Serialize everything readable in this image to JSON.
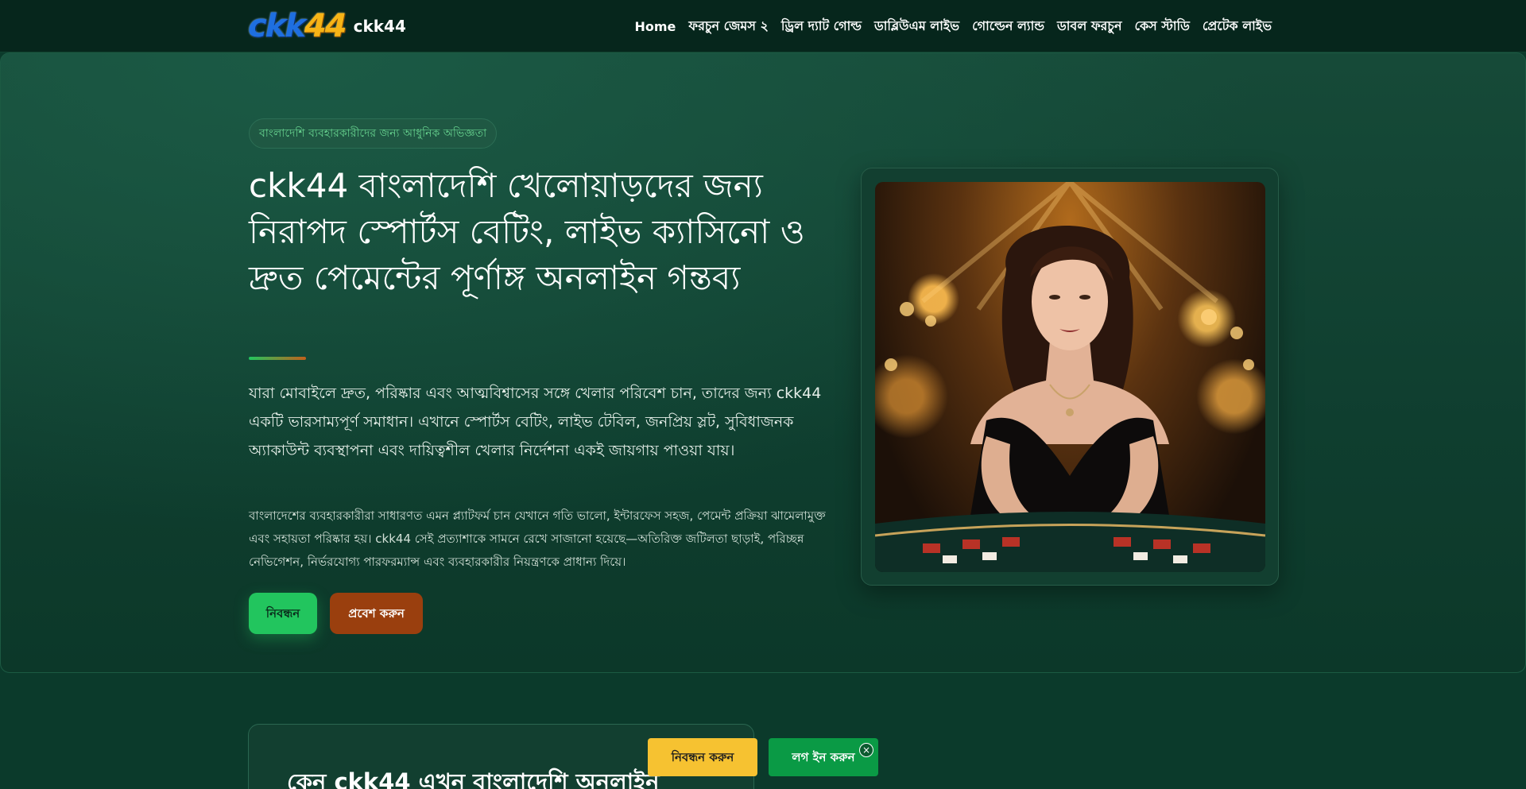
{
  "header": {
    "logo": {
      "part1": "ckk",
      "part2": "44"
    },
    "brand_name": "ckk44",
    "nav": [
      "Home",
      "ফরচুন জেমস ২",
      "ড্রিল দ্যাট গোল্ড",
      "ডাব্লিউএম লাইভ",
      "গোল্ডেন ল্যান্ড",
      "ডাবল ফরচুন",
      "কেস স্টাডি",
      "প্রেটেক লাইভ"
    ]
  },
  "hero": {
    "eyebrow": "বাংলাদেশি ব্যবহারকারীদের জন্য আধুনিক অভিজ্ঞতা",
    "title": "ckk44 বাংলাদেশি খেলোয়াড়দের জন্য নিরাপদ স্পোর্টস বেটিং, লাইভ ক্যাসিনো ও দ্রুত পেমেন্টের পূর্ণাঙ্গ অনলাইন গন্তব্য",
    "lead": "যারা মোবাইলে দ্রুত, পরিষ্কার এবং আত্মবিশ্বাসের সঙ্গে খেলার পরিবেশ চান, তাদের জন্য ckk44 একটি ভারসাম্যপূর্ণ সমাধান। এখানে স্পোর্টস বেটিং, লাইভ টেবিল, জনপ্রিয় স্লট, সুবিধাজনক অ্যাকাউন্ট ব্যবস্থাপনা এবং দায়িত্বশীল খেলার নির্দেশনা একই জায়গায় পাওয়া যায়।",
    "sub": "বাংলাদেশের ব্যবহারকারীরা সাধারণত এমন প্ল্যাটফর্ম চান যেখানে গতি ভালো, ইন্টারফেস সহজ, পেমেন্ট প্রক্রিয়া ঝামেলামুক্ত এবং সহায়তা পরিষ্কার হয়। ckk44 সেই প্রত্যাশাকে সামনে রেখে সাজানো হয়েছে—অতিরিক্ত জটিলতা ছাড়াই, পরিচ্ছন্ন নেভিগেশন, নির্ভরযোগ্য পারফরম্যান্স এবং ব্যবহারকারীর নিয়ন্ত্রণকে প্রাধান্য দিয়ে।",
    "register_label": "নিবন্ধন",
    "login_label": "প্রবেশ করুন"
  },
  "why": {
    "title": "কেন ckk44 এখন বাংলাদেশি অনলাইন"
  },
  "sticky": {
    "register_label": "নিবন্ধন করুন",
    "login_label": "লগ ইন করুন",
    "close_icon": "×"
  },
  "colors": {
    "background": "#0b3a2b",
    "accent_green": "#22c55e",
    "accent_orange": "#9a3f0e",
    "sticky_yellow": "#f6c231",
    "sticky_green": "#0a9a45"
  }
}
